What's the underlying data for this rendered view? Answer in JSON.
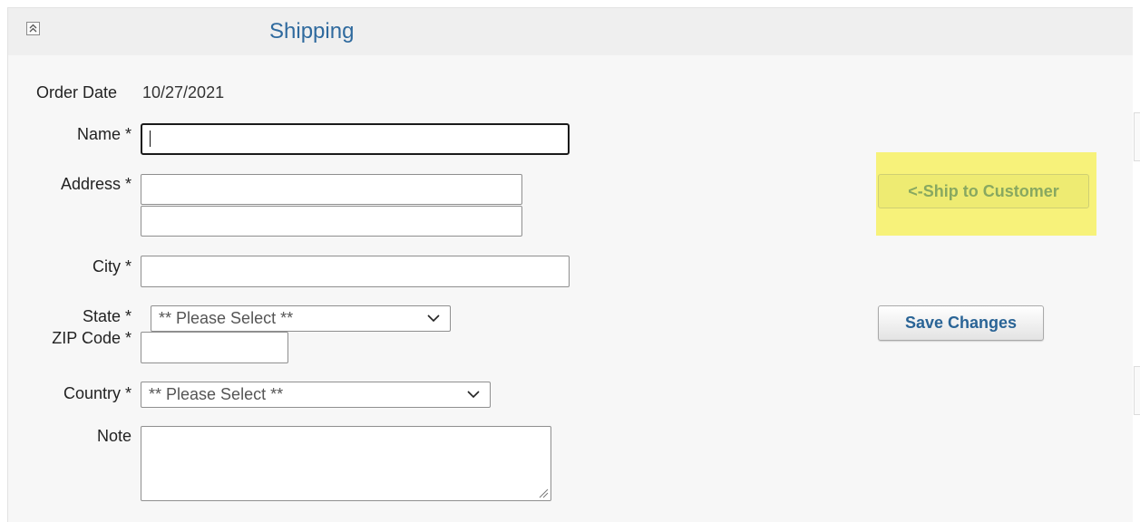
{
  "panel": {
    "title": "Shipping",
    "collapse_icon": "double-chevron-up-icon"
  },
  "form": {
    "order_date_label": "Order Date",
    "order_date_value": "10/27/2021",
    "name_label": "Name *",
    "name_value": "",
    "address_label": "Address *",
    "address_line1_value": "",
    "address_line2_value": "",
    "city_label": "City *",
    "city_value": "",
    "state_label": "State *",
    "state_selected": "** Please Select **",
    "zip_label": "ZIP Code *",
    "zip_value": "",
    "country_label": "Country *",
    "country_selected": "** Please Select **",
    "note_label": "Note",
    "note_value": ""
  },
  "actions": {
    "ship_to_customer_label": "<-Ship to Customer",
    "save_changes_label": "Save Changes",
    "highlight_color": "#f7f27a"
  },
  "colors": {
    "title": "#2f6a9e",
    "save_text": "#2a6496",
    "panel_bg": "#f7f7f7"
  }
}
